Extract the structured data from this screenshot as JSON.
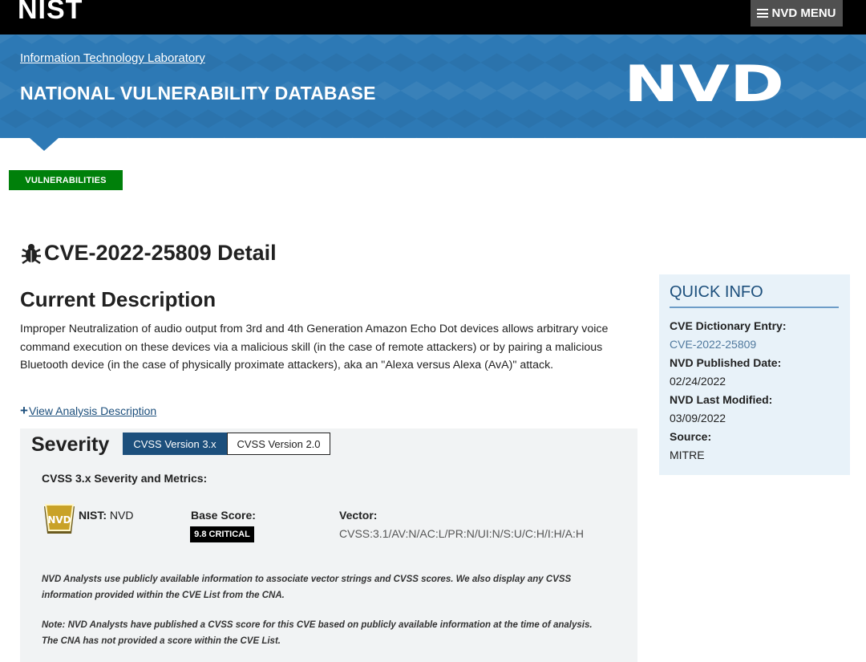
{
  "header": {
    "logo_text": "NIST",
    "menu_label": "NVD MENU"
  },
  "banner": {
    "lab_link": "Information Technology Laboratory",
    "title": "NATIONAL VULNERABILITY DATABASE",
    "logo_text": "NVD",
    "color": "#2d79b5"
  },
  "section_tag": {
    "label": "VULNERABILITIES",
    "color": "#00800a"
  },
  "page": {
    "title": "CVE-2022-25809 Detail",
    "icon": "bug-icon"
  },
  "description": {
    "heading": "Current Description",
    "text": "Improper Neutralization of audio output from 3rd and 4th Generation Amazon Echo Dot devices allows arbitrary voice command execution on these devices via a malicious skill (in the case of remote attackers) or by pairing a malicious Bluetooth device (in the case of physically proximate attackers), aka an \"Alexa versus Alexa (AvA)\" attack.",
    "view_analysis": "View Analysis Description"
  },
  "severity": {
    "heading": "Severity",
    "tabs": [
      {
        "label": "CVSS Version 3.x",
        "active": true
      },
      {
        "label": "CVSS Version 2.0",
        "active": false
      }
    ],
    "metrics_heading": "CVSS 3.x Severity and Metrics:",
    "source_label": "NIST:",
    "source_value": "NVD",
    "base_score_label": "Base Score:",
    "base_score_value": "9.8 CRITICAL",
    "vector_label": "Vector:",
    "vector_value": "CVSS:3.1/AV:N/AC:L/PR:N/UI:N/S:U/C:H/I:H/A:H",
    "note1": "NVD Analysts use publicly available information to associate vector strings and CVSS scores. We also display any CVSS information provided within the CVE List from the CNA.",
    "note2": "Note: NVD Analysts have published a CVSS score for this CVE based on publicly available information at the time of analysis. The CNA has not provided a score within the CVE List."
  },
  "quick_info": {
    "title": "QUICK INFO",
    "cve_entry_label": "CVE Dictionary Entry:",
    "cve_entry_value": "CVE-2022-25809",
    "published_label": "NVD Published Date:",
    "published_value": "02/24/2022",
    "modified_label": "NVD Last Modified:",
    "modified_value": "03/09/2022",
    "source_label": "Source:",
    "source_value": "MITRE"
  }
}
